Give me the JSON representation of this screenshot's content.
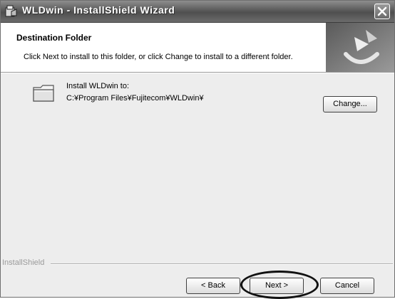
{
  "window": {
    "title": "WLDwin - InstallShield Wizard"
  },
  "header": {
    "title": "Destination Folder",
    "description": "Click Next to install to this folder, or click Change to install to a different folder."
  },
  "body": {
    "install_label": "Install WLDwin to:",
    "install_path": "C:¥Program Files¥Fujitecom¥WLDwin¥",
    "change_button": "Change..."
  },
  "footer": {
    "brand": "InstallShield",
    "back_button": "< Back",
    "next_button": "Next >",
    "cancel_button": "Cancel"
  },
  "icons": {
    "app": "installer-icon",
    "close": "close-icon",
    "folder": "folder-icon",
    "header_graphic": "installshield-logo-icon"
  },
  "colors": {
    "titlebar": "#5a5a5a",
    "window_bg": "#ededed",
    "header_bg": "#ffffff"
  }
}
